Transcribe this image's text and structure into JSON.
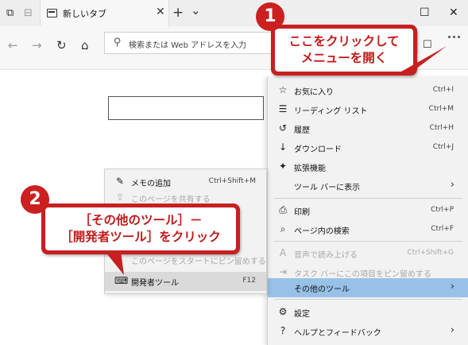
{
  "tab": {
    "title": "新しいタブ",
    "new_tab_symbol": "+",
    "list_symbol": "⌄",
    "close_symbol": "✕"
  },
  "window": {
    "maximize_symbol": "☐",
    "close_symbol": "✕"
  },
  "address_bar": {
    "placeholder": "検索または Web アドレスを入力"
  },
  "main_menu": {
    "items": [
      {
        "icon": "star-list-icon",
        "glyph": "☆",
        "label": "お気に入り",
        "shortcut": "Ctrl+I"
      },
      {
        "icon": "reading-list-icon",
        "glyph": "☰",
        "label": "リーディング リスト",
        "shortcut": "Ctrl+M"
      },
      {
        "icon": "history-icon",
        "glyph": "↺",
        "label": "履歴",
        "shortcut": "Ctrl+H"
      },
      {
        "icon": "download-icon",
        "glyph": "↓",
        "label": "ダウンロード",
        "shortcut": "Ctrl+J"
      },
      {
        "icon": "extensions-icon",
        "glyph": "✦",
        "label": "拡張機能",
        "shortcut": ""
      },
      {
        "icon": "",
        "glyph": "",
        "label": "ツール バーに表示",
        "shortcut": "",
        "arrow": "›"
      },
      {
        "icon": "print-icon",
        "glyph": "⎙",
        "label": "印刷",
        "shortcut": "Ctrl+P"
      },
      {
        "icon": "find-icon",
        "glyph": "⌕",
        "label": "ページ内の検索",
        "shortcut": "Ctrl+F"
      },
      {
        "icon": "read-aloud-icon",
        "glyph": "A",
        "label": "音声で読み上げる",
        "shortcut": "Ctrl+Shift+G",
        "disabled": true
      },
      {
        "icon": "pin-icon",
        "glyph": "⇥",
        "label": "タスク バーにこの項目をピン留めする",
        "shortcut": "",
        "disabled": true
      },
      {
        "icon": "",
        "glyph": "",
        "label": "その他のツール",
        "shortcut": "",
        "arrow": "›",
        "highlighted": true
      },
      {
        "icon": "settings-icon",
        "glyph": "⚙",
        "label": "設定",
        "shortcut": ""
      },
      {
        "icon": "help-icon",
        "glyph": "?",
        "label": "ヘルプとフィードバック",
        "shortcut": "",
        "arrow": "›"
      }
    ]
  },
  "submenu": {
    "items": [
      {
        "icon": "pen-icon",
        "glyph": "✎",
        "label": "メモの追加",
        "shortcut": "Ctrl+Shift+M"
      },
      {
        "icon": "share-icon",
        "glyph": "⇪",
        "label": "このページを共有する",
        "shortcut": "",
        "disabled": true
      },
      {
        "icon": "",
        "glyph": "",
        "label": "このページをスタートにピン留めする",
        "shortcut": "",
        "disabled": true
      },
      {
        "icon": "devtools-icon",
        "glyph": "⌨",
        "label": "開発者ツール",
        "shortcut": "F12",
        "selected": true
      }
    ]
  },
  "callouts": [
    {
      "number": "1",
      "lines": [
        "ここをクリックして",
        "メニューを開く"
      ]
    },
    {
      "number": "2",
      "lines": [
        "［その他のツール］－",
        "［開発者ツール］をクリック"
      ]
    }
  ],
  "colors": {
    "accent_red": "#c62020",
    "highlight_blue": "#98c1e8"
  }
}
